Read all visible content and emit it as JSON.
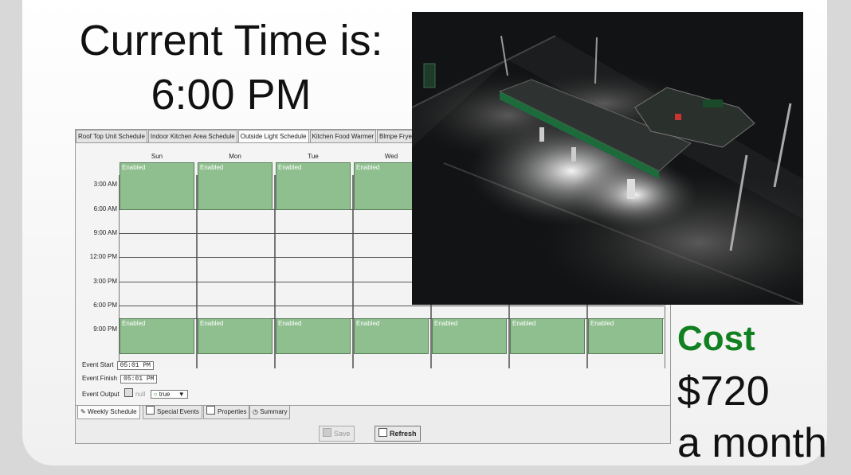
{
  "header": {
    "line1": "Current Time is:",
    "line2": "6:00 PM"
  },
  "tabs": [
    "Roof Top Unit Schedule",
    "Indoor Kitchen Area Schedule",
    "Outside Light Schedule",
    "Kitchen Food Warmer",
    "Blmpe Fryer"
  ],
  "active_tab": "Outside Light Schedule",
  "days": [
    "Sun",
    "Mon",
    "Tue",
    "Wed"
  ],
  "times": [
    "3:00 AM",
    "6:00 AM",
    "9:00 AM",
    "12:00 PM",
    "3:00 PM",
    "6:00 PM",
    "9:00 PM"
  ],
  "block_label": "Enabled",
  "event": {
    "start_label": "Event Start",
    "start_value": "05:01 PM",
    "finish_label": "Event Finish",
    "finish_value": "05:01 PM",
    "output_label": "Event Output",
    "null_label": "null",
    "output_value": "true"
  },
  "bottom_tabs": [
    "Weekly Schedule",
    "Special Events",
    "Properties",
    "Summary"
  ],
  "buttons": {
    "save": "Save",
    "refresh": "Refresh"
  },
  "cost": {
    "title": "Cost",
    "amount": "$720",
    "period": "a month"
  },
  "colors": {
    "enabled_block": "#8fbf8f",
    "cost_title": "#108020"
  }
}
